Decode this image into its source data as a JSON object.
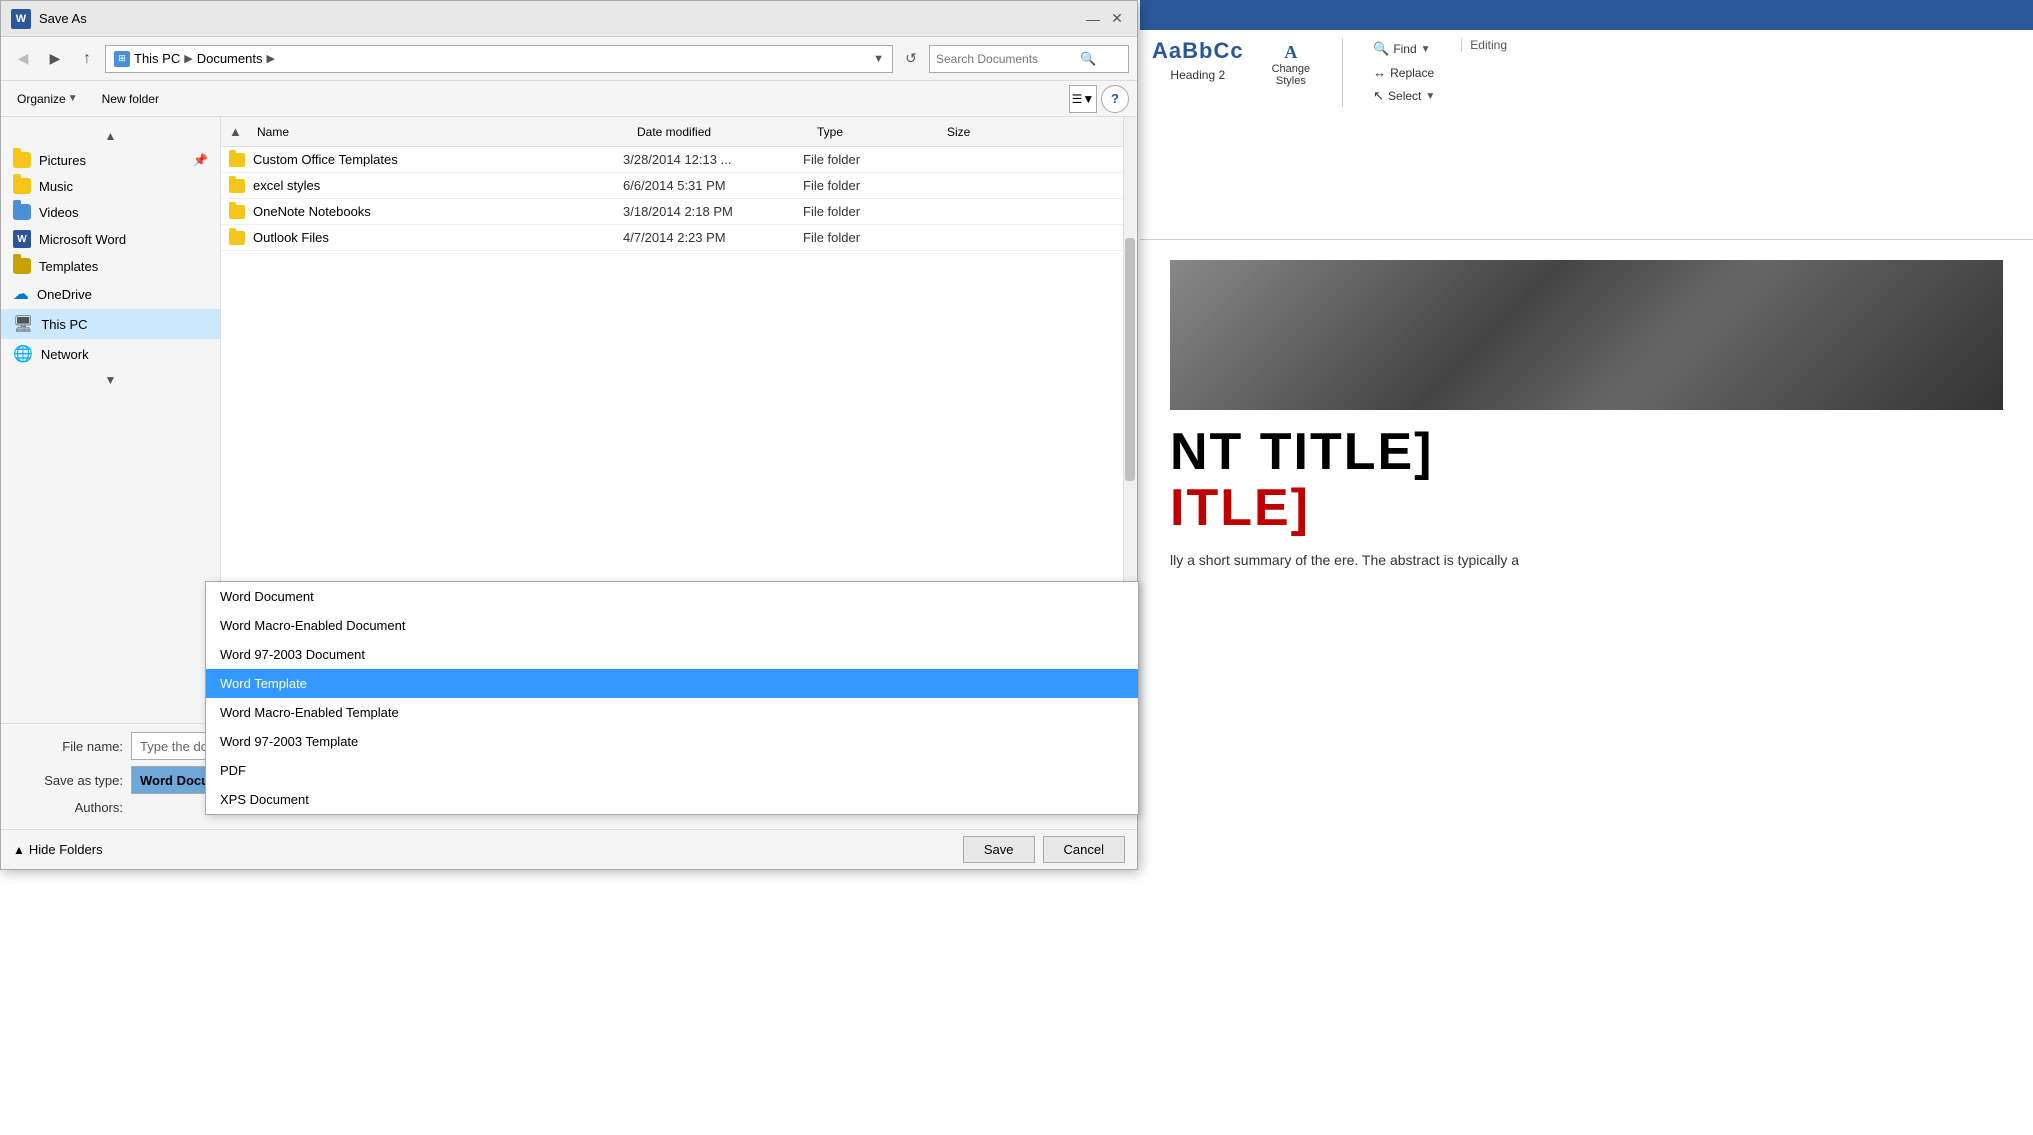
{
  "dialog": {
    "title": "Save As",
    "word_icon": "W",
    "breadcrumb": {
      "icon": "⊞",
      "parts": [
        "This PC",
        "Documents"
      ]
    },
    "search_placeholder": "Search Documents",
    "toolbar": {
      "organize_label": "Organize",
      "new_folder_label": "New folder"
    },
    "file_list": {
      "columns": {
        "name": "Name",
        "date_modified": "Date modified",
        "type": "Type",
        "size": "Size"
      },
      "files": [
        {
          "name": "Custom Office Templates",
          "date": "3/28/2014 12:13 ...",
          "type": "File folder",
          "size": ""
        },
        {
          "name": "excel styles",
          "date": "6/6/2014 5:31 PM",
          "type": "File folder",
          "size": ""
        },
        {
          "name": "OneNote Notebooks",
          "date": "3/18/2014 2:18 PM",
          "type": "File folder",
          "size": ""
        },
        {
          "name": "Outlook Files",
          "date": "4/7/2014 2:23 PM",
          "type": "File folder",
          "size": ""
        }
      ]
    },
    "sidebar": {
      "items": [
        {
          "label": "Pictures",
          "icon": "folder",
          "pinned": true
        },
        {
          "label": "Music",
          "icon": "folder"
        },
        {
          "label": "Videos",
          "icon": "folder-blue"
        },
        {
          "label": "Microsoft Word",
          "icon": "word"
        },
        {
          "label": "Templates",
          "icon": "folder-dark"
        },
        {
          "label": "OneDrive",
          "icon": "onedrive"
        },
        {
          "label": "This PC",
          "icon": "thispc",
          "selected": true
        },
        {
          "label": "Network",
          "icon": "network"
        }
      ]
    },
    "form": {
      "file_name_label": "File name:",
      "file_name_placeholder": "Type the document title",
      "save_type_label": "Save as type:",
      "save_type_value": "Word Document",
      "authors_label": "Authors:"
    },
    "dropdown": {
      "options": [
        {
          "label": "Word Document",
          "selected": false
        },
        {
          "label": "Word Macro-Enabled Document",
          "selected": false
        },
        {
          "label": "Word 97-2003 Document",
          "selected": false
        },
        {
          "label": "Word Template",
          "selected": true
        },
        {
          "label": "Word Macro-Enabled Template",
          "selected": false
        },
        {
          "label": "Word 97-2003 Template",
          "selected": false
        },
        {
          "label": "PDF",
          "selected": false
        },
        {
          "label": "XPS Document",
          "selected": false
        }
      ]
    },
    "footer": {
      "hide_folders_label": "Hide Folders",
      "save_btn": "Save",
      "cancel_btn": "Cancel"
    }
  },
  "ribbon": {
    "style_preview": "AaBbCc",
    "heading_label": "Heading 2",
    "change_styles_label": "Change\nStyles",
    "find_label": "Find",
    "replace_label": "Replace",
    "select_label": "Select",
    "editing_label": "Editing"
  },
  "doc": {
    "title_line1": "NT TITLE]",
    "title_line2": "ITLE]",
    "body_text": "lly a short summary of the\nere. The abstract is typically a"
  }
}
